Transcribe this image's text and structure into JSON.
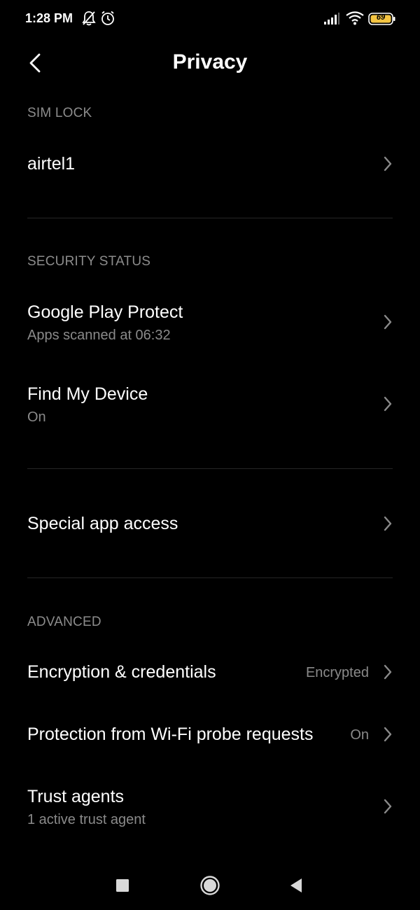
{
  "status_bar": {
    "time": "1:28 PM",
    "battery": "69",
    "icons": [
      "mute-icon",
      "alarm-icon",
      "signal-icon",
      "wifi-icon",
      "battery-icon"
    ]
  },
  "header": {
    "title": "Privacy",
    "back_icon": "chevron-left-icon"
  },
  "sections": {
    "sim_lock": {
      "header": "SIM LOCK",
      "items": [
        {
          "title": "airtel1"
        }
      ]
    },
    "security_status": {
      "header": "SECURITY STATUS",
      "items": [
        {
          "title": "Google Play Protect",
          "subtitle": "Apps scanned at 06:32"
        },
        {
          "title": "Find My Device",
          "subtitle": "On"
        }
      ]
    },
    "special": {
      "items": [
        {
          "title": "Special app access"
        }
      ]
    },
    "advanced": {
      "header": "ADVANCED",
      "items": [
        {
          "title": "Encryption & credentials",
          "value": "Encrypted"
        },
        {
          "title": "Protection from Wi-Fi probe requests",
          "value": "On"
        },
        {
          "title": "Trust agents",
          "subtitle": "1 active trust agent"
        }
      ]
    }
  },
  "nav_bar": {
    "icons": [
      "recents-square-icon",
      "home-circle-icon",
      "back-triangle-icon"
    ]
  },
  "colors": {
    "background": "#000000",
    "text_primary": "#ffffff",
    "text_secondary": "#8a8a8a",
    "divider": "#262626",
    "battery_fill": "#f5c542"
  }
}
